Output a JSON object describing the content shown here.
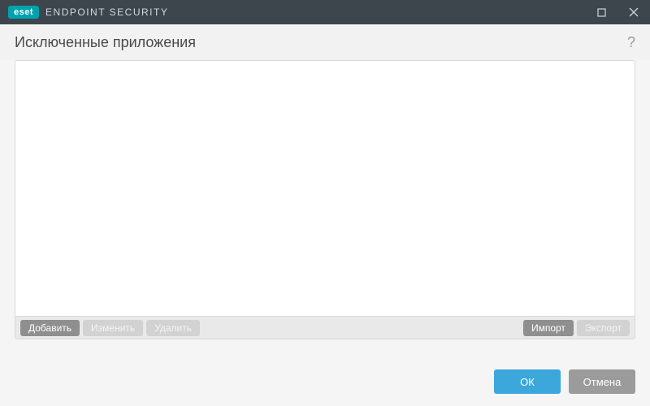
{
  "titlebar": {
    "brand_badge": "eset",
    "brand_text": "ENDPOINT SECURITY"
  },
  "header": {
    "title": "Исключенные приложения",
    "help_symbol": "?"
  },
  "toolbar": {
    "add": "Добавить",
    "edit": "Изменить",
    "delete": "Удалить",
    "import": "Импорт",
    "export": "Экспорт"
  },
  "list": {
    "items": []
  },
  "footer": {
    "ok": "ОК",
    "cancel": "Отмена"
  }
}
